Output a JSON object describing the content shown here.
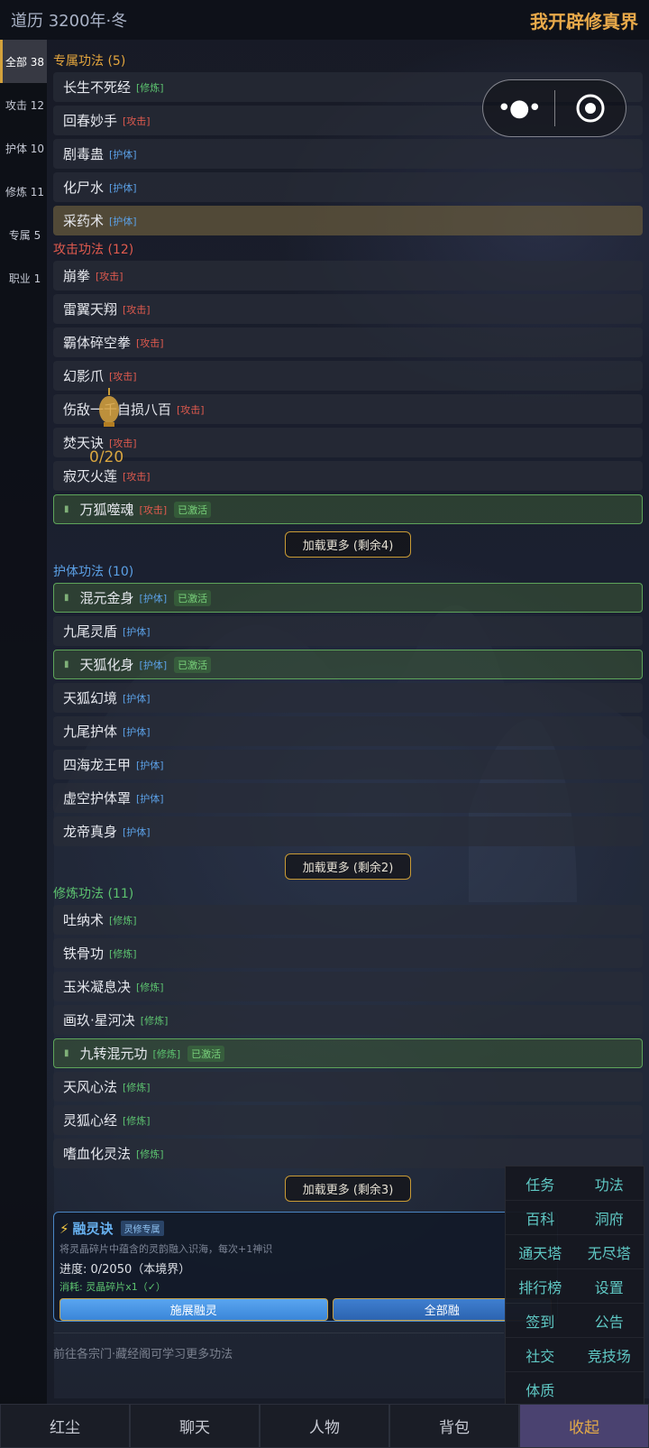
{
  "topbar": {
    "date": "道历 3200年·冬",
    "title": "我开辟修真界"
  },
  "sidebar": [
    {
      "label": "全部 38",
      "active": true
    },
    {
      "label": "攻击 12"
    },
    {
      "label": "护体 10"
    },
    {
      "label": "修炼 11"
    },
    {
      "label": "专属 5"
    },
    {
      "label": "职业 1"
    }
  ],
  "sections": {
    "exclusive": {
      "title": "专属功法 (5)",
      "items": [
        {
          "name": "长生不死经",
          "tag": "[修炼]"
        },
        {
          "name": "回春妙手",
          "tag": "[攻击]"
        },
        {
          "name": "剧毒蛊",
          "tag": "[护体]"
        },
        {
          "name": "化尸水",
          "tag": "[护体]"
        },
        {
          "name": "采药术",
          "tag": "[护体]"
        }
      ]
    },
    "attack": {
      "title": "攻击功法 (12)",
      "items": [
        {
          "name": "崩拳",
          "tag": "[攻击]"
        },
        {
          "name": "雷翼天翔",
          "tag": "[攻击]"
        },
        {
          "name": "霸体碎空拳",
          "tag": "[攻击]"
        },
        {
          "name": "幻影爪",
          "tag": "[攻击]"
        },
        {
          "name": "伤敌一千自损八百",
          "tag": "[攻击]"
        },
        {
          "name": "焚天诀",
          "tag": "[攻击]"
        },
        {
          "name": "寂灭火莲",
          "tag": "[攻击]"
        },
        {
          "name": "万狐噬魂",
          "tag": "[攻击]",
          "badge": "已激活"
        }
      ],
      "more": "加载更多 (剩余4)"
    },
    "defense": {
      "title": "护体功法 (10)",
      "items": [
        {
          "name": "混元金身",
          "tag": "[护体]",
          "badge": "已激活"
        },
        {
          "name": "九尾灵盾",
          "tag": "[护体]"
        },
        {
          "name": "天狐化身",
          "tag": "[护体]",
          "badge": "已激活"
        },
        {
          "name": "天狐幻境",
          "tag": "[护体]"
        },
        {
          "name": "九尾护体",
          "tag": "[护体]"
        },
        {
          "name": "四海龙王甲",
          "tag": "[护体]"
        },
        {
          "name": "虚空护体罩",
          "tag": "[护体]"
        },
        {
          "name": "龙帝真身",
          "tag": "[护体]"
        }
      ],
      "more": "加载更多 (剩余2)"
    },
    "cultivation": {
      "title": "修炼功法 (11)",
      "items": [
        {
          "name": "吐纳术",
          "tag": "[修炼]"
        },
        {
          "name": "铁骨功",
          "tag": "[修炼]"
        },
        {
          "name": "玉米凝息决",
          "tag": "[修炼]"
        },
        {
          "name": "画玖·星河决",
          "tag": "[修炼]"
        },
        {
          "name": "九转混元功",
          "tag": "[修炼]",
          "badge": "已激活"
        },
        {
          "name": "天风心法",
          "tag": "[修炼]"
        },
        {
          "name": "灵狐心经",
          "tag": "[修炼]"
        },
        {
          "name": "嗜血化灵法",
          "tag": "[修炼]"
        }
      ],
      "more": "加载更多 (剩余3)"
    }
  },
  "lantern_counter": "0/20",
  "panel": {
    "title": "融灵诀",
    "badge": "灵修专属",
    "desc": "将灵晶碎片中蕴含的灵韵融入识海，每次+1神识",
    "progress": "进度: 0/2050（本境界）",
    "cost": "消耗: 灵晶碎片x1（✓）",
    "primary_btn": "施展融灵",
    "secondary_btn": "全部融"
  },
  "footer_note": "前往各宗门·藏经阁可学习更多功法",
  "menu": [
    "任务",
    "功法",
    "百科",
    "洞府",
    "通天塔",
    "无尽塔",
    "排行榜",
    "设置",
    "签到",
    "公告",
    "社交",
    "竞技场",
    "体质"
  ],
  "tabs": [
    {
      "label": "红尘"
    },
    {
      "label": "聊天"
    },
    {
      "label": "人物"
    },
    {
      "label": "背包"
    },
    {
      "label": "收起",
      "active": true
    }
  ]
}
